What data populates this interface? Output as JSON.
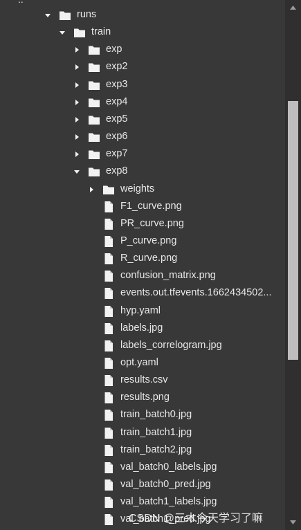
{
  "parent_label": "..",
  "tree": [
    {
      "label": "runs",
      "type": "folder",
      "depth": 0,
      "state": "expanded"
    },
    {
      "label": "train",
      "type": "folder",
      "depth": 1,
      "state": "expanded"
    },
    {
      "label": "exp",
      "type": "folder",
      "depth": 2,
      "state": "collapsed"
    },
    {
      "label": "exp2",
      "type": "folder",
      "depth": 2,
      "state": "collapsed"
    },
    {
      "label": "exp3",
      "type": "folder",
      "depth": 2,
      "state": "collapsed"
    },
    {
      "label": "exp4",
      "type": "folder",
      "depth": 2,
      "state": "collapsed"
    },
    {
      "label": "exp5",
      "type": "folder",
      "depth": 2,
      "state": "collapsed"
    },
    {
      "label": "exp6",
      "type": "folder",
      "depth": 2,
      "state": "collapsed"
    },
    {
      "label": "exp7",
      "type": "folder",
      "depth": 2,
      "state": "collapsed"
    },
    {
      "label": "exp8",
      "type": "folder",
      "depth": 2,
      "state": "expanded"
    },
    {
      "label": "weights",
      "type": "folder",
      "depth": 3,
      "state": "collapsed"
    },
    {
      "label": "F1_curve.png",
      "type": "file",
      "depth": 3
    },
    {
      "label": "PR_curve.png",
      "type": "file",
      "depth": 3
    },
    {
      "label": "P_curve.png",
      "type": "file",
      "depth": 3
    },
    {
      "label": "R_curve.png",
      "type": "file",
      "depth": 3
    },
    {
      "label": "confusion_matrix.png",
      "type": "file",
      "depth": 3
    },
    {
      "label": "events.out.tfevents.1662434502...",
      "type": "file",
      "depth": 3
    },
    {
      "label": "hyp.yaml",
      "type": "file",
      "depth": 3
    },
    {
      "label": "labels.jpg",
      "type": "file",
      "depth": 3
    },
    {
      "label": "labels_correlogram.jpg",
      "type": "file",
      "depth": 3
    },
    {
      "label": "opt.yaml",
      "type": "file",
      "depth": 3
    },
    {
      "label": "results.csv",
      "type": "file",
      "depth": 3
    },
    {
      "label": "results.png",
      "type": "file",
      "depth": 3
    },
    {
      "label": "train_batch0.jpg",
      "type": "file",
      "depth": 3
    },
    {
      "label": "train_batch1.jpg",
      "type": "file",
      "depth": 3
    },
    {
      "label": "train_batch2.jpg",
      "type": "file",
      "depth": 3
    },
    {
      "label": "val_batch0_labels.jpg",
      "type": "file",
      "depth": 3
    },
    {
      "label": "val_batch0_pred.jpg",
      "type": "file",
      "depth": 3
    },
    {
      "label": "val_batch1_labels.jpg",
      "type": "file",
      "depth": 3
    },
    {
      "label": "val_batch1_pred.jpg",
      "type": "file",
      "depth": 3
    }
  ],
  "watermark": "CSDN @三木今天学习了嘛",
  "icons": {
    "folder": "folder-icon",
    "file": "file-icon",
    "expanded": "chevron-down-icon",
    "collapsed": "chevron-right-icon"
  },
  "colors": {
    "background": "#383838",
    "text": "#e8e8e8",
    "scrollbar_track": "#2f2f2f",
    "scrollbar_thumb": "#bdbdbd"
  }
}
